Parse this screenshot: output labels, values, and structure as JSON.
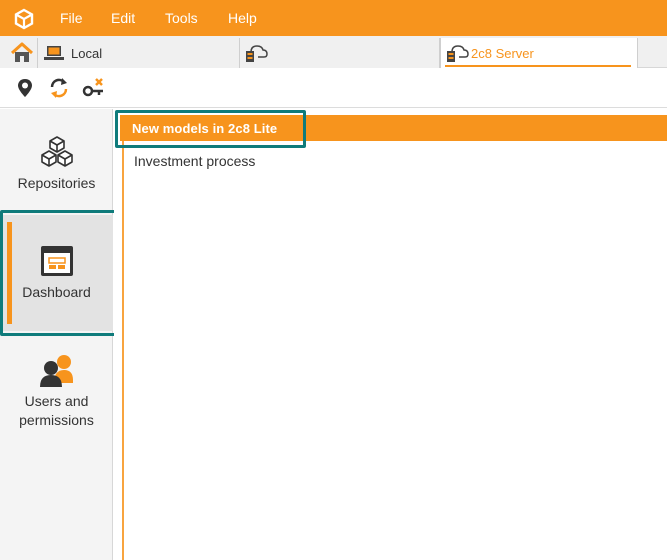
{
  "menu": {
    "items": [
      "File",
      "Edit",
      "Tools",
      "Help"
    ]
  },
  "tabs": {
    "local_label": "Local",
    "server_label": "2c8 Server"
  },
  "toolbar": {
    "icons": [
      "location-pin-icon",
      "sync-icon",
      "disconnect-key-icon"
    ]
  },
  "nav": {
    "items": [
      {
        "label": "Repositories",
        "icon": "cubes-icon"
      },
      {
        "label": "Dashboard",
        "icon": "dashboard-icon",
        "selected": true
      },
      {
        "label": "Users and permissions",
        "icon": "users-icon"
      }
    ]
  },
  "content": {
    "header": "New models in 2c8 Lite",
    "items": [
      "Investment process"
    ]
  },
  "colors": {
    "accent": "#f7941d",
    "highlight": "#0f7b7b"
  }
}
